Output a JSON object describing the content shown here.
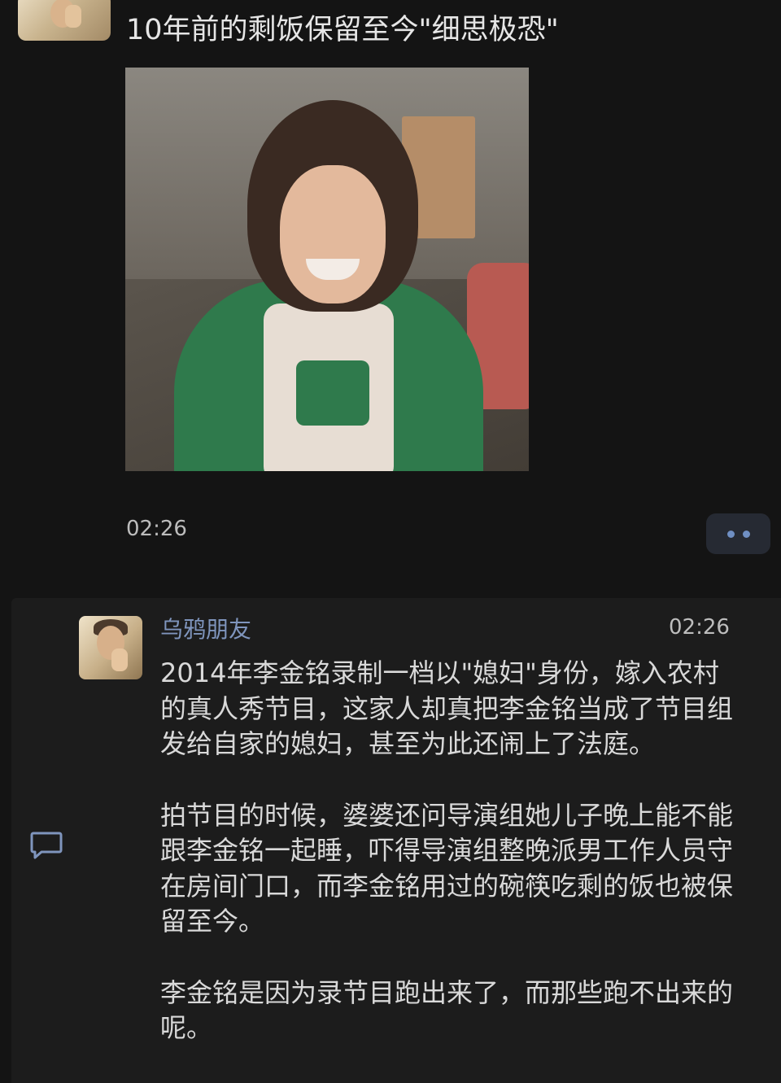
{
  "post": {
    "title": "10年前的剩饭保留至今\"细思极恐\"",
    "time": "02:26"
  },
  "comment": {
    "author": "乌鸦朋友",
    "time": "02:26",
    "paragraphs": [
      "2014年李金铭录制一档以\"媳妇\"身份，嫁入农村的真人秀节目，这家人却真把李金铭当成了节目组发给自家的媳妇，甚至为此还闹上了法庭。",
      "拍节目的时候，婆婆还问导演组她儿子晚上能不能跟李金铭一起睡，吓得导演组整晚派男工作人员守在房间门口，而李金铭用过的碗筷吃剩的饭也被保留至今。",
      "李金铭是因为录节目跑出来了，而那些跑不出来的呢。"
    ]
  },
  "icons": {
    "more": "more-dots-icon",
    "reply": "comment-bubble-icon"
  },
  "colors": {
    "background": "#141414",
    "card": "#1c1c1c",
    "author": "#7f95bd",
    "text": "#d9d9d9",
    "accent_dots": "#6f8fc3"
  }
}
